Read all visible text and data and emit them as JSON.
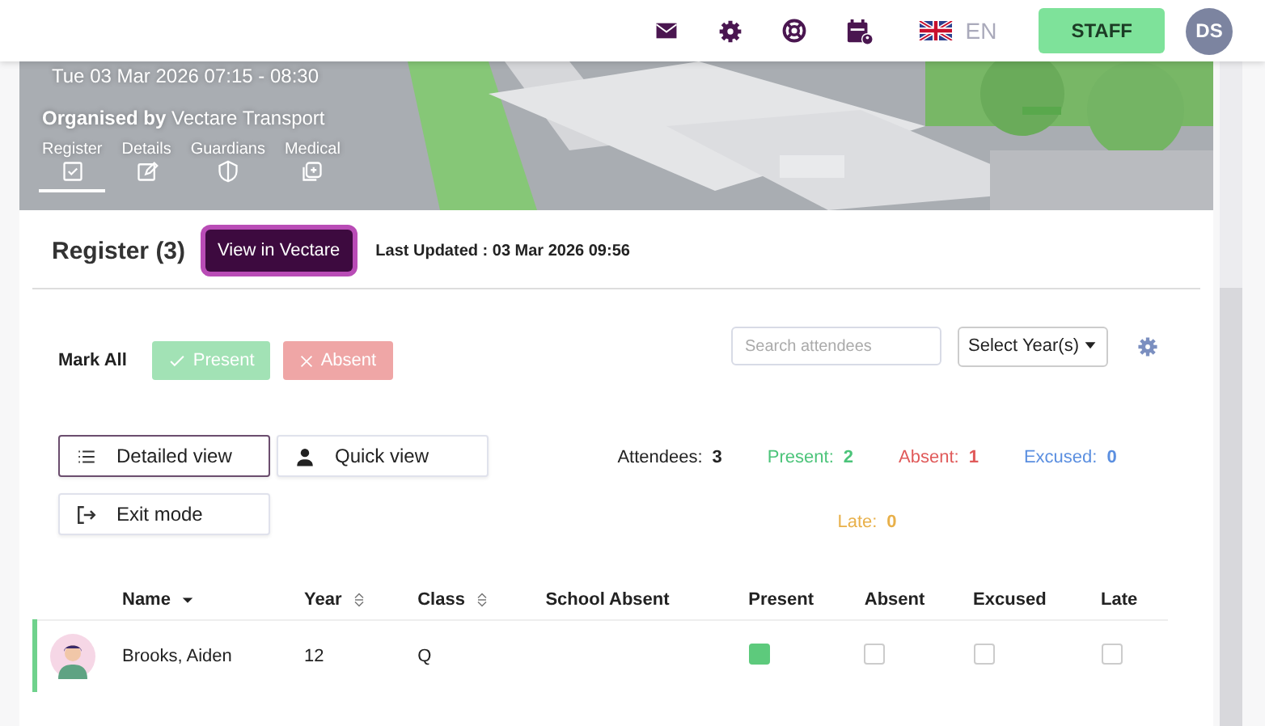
{
  "top_bar": {
    "language": "EN",
    "role_button": "STAFF",
    "avatar": "DS"
  },
  "banner": {
    "kind": "picture",
    "datetime": "Tue 03 Mar 2026 07:15 - 08:30",
    "organiser_label": "Organised by",
    "organiser": "Vectare Transport",
    "tabs": [
      {
        "label": "Register",
        "selected": true
      },
      {
        "label": "Details",
        "selected": false
      },
      {
        "label": "Guardians",
        "selected": false
      },
      {
        "label": "Medical",
        "selected": false
      }
    ]
  },
  "register": {
    "title": "Register (3)",
    "view_button": "View in Vectare",
    "last_updated": "Last Updated : 03 Mar 2026 09:56"
  },
  "mark_all": {
    "label": "Mark All",
    "present": "Present",
    "absent": "Absent"
  },
  "search": {
    "placeholder": "Search attendees"
  },
  "year_select": "Select Year(s)",
  "view_buttons": [
    {
      "label": "Detailed view",
      "selected": true
    },
    {
      "label": "Quick view",
      "selected": false
    },
    {
      "label": "Exit mode",
      "selected": false
    }
  ],
  "stats": [
    {
      "label": "Attendees:",
      "value": "3",
      "color": "#222222"
    },
    {
      "label": "Present:",
      "value": "2",
      "color": "#4cc47a"
    },
    {
      "label": "Absent:",
      "value": "1",
      "color": "#e05a5a"
    },
    {
      "label": "Excused:",
      "value": "0",
      "color": "#5b8fe0"
    },
    {
      "label": "Late:",
      "value": "0",
      "color": "#e8b04a"
    }
  ],
  "table": {
    "columns": [
      "Name",
      "Year",
      "Class",
      "School Absent",
      "Present",
      "Absent",
      "Excused",
      "Late"
    ],
    "rows": [
      {
        "name": "Brooks, Aiden",
        "year": "12",
        "class": "Q",
        "present": true,
        "absent": false,
        "excused": false,
        "late": false
      }
    ]
  }
}
